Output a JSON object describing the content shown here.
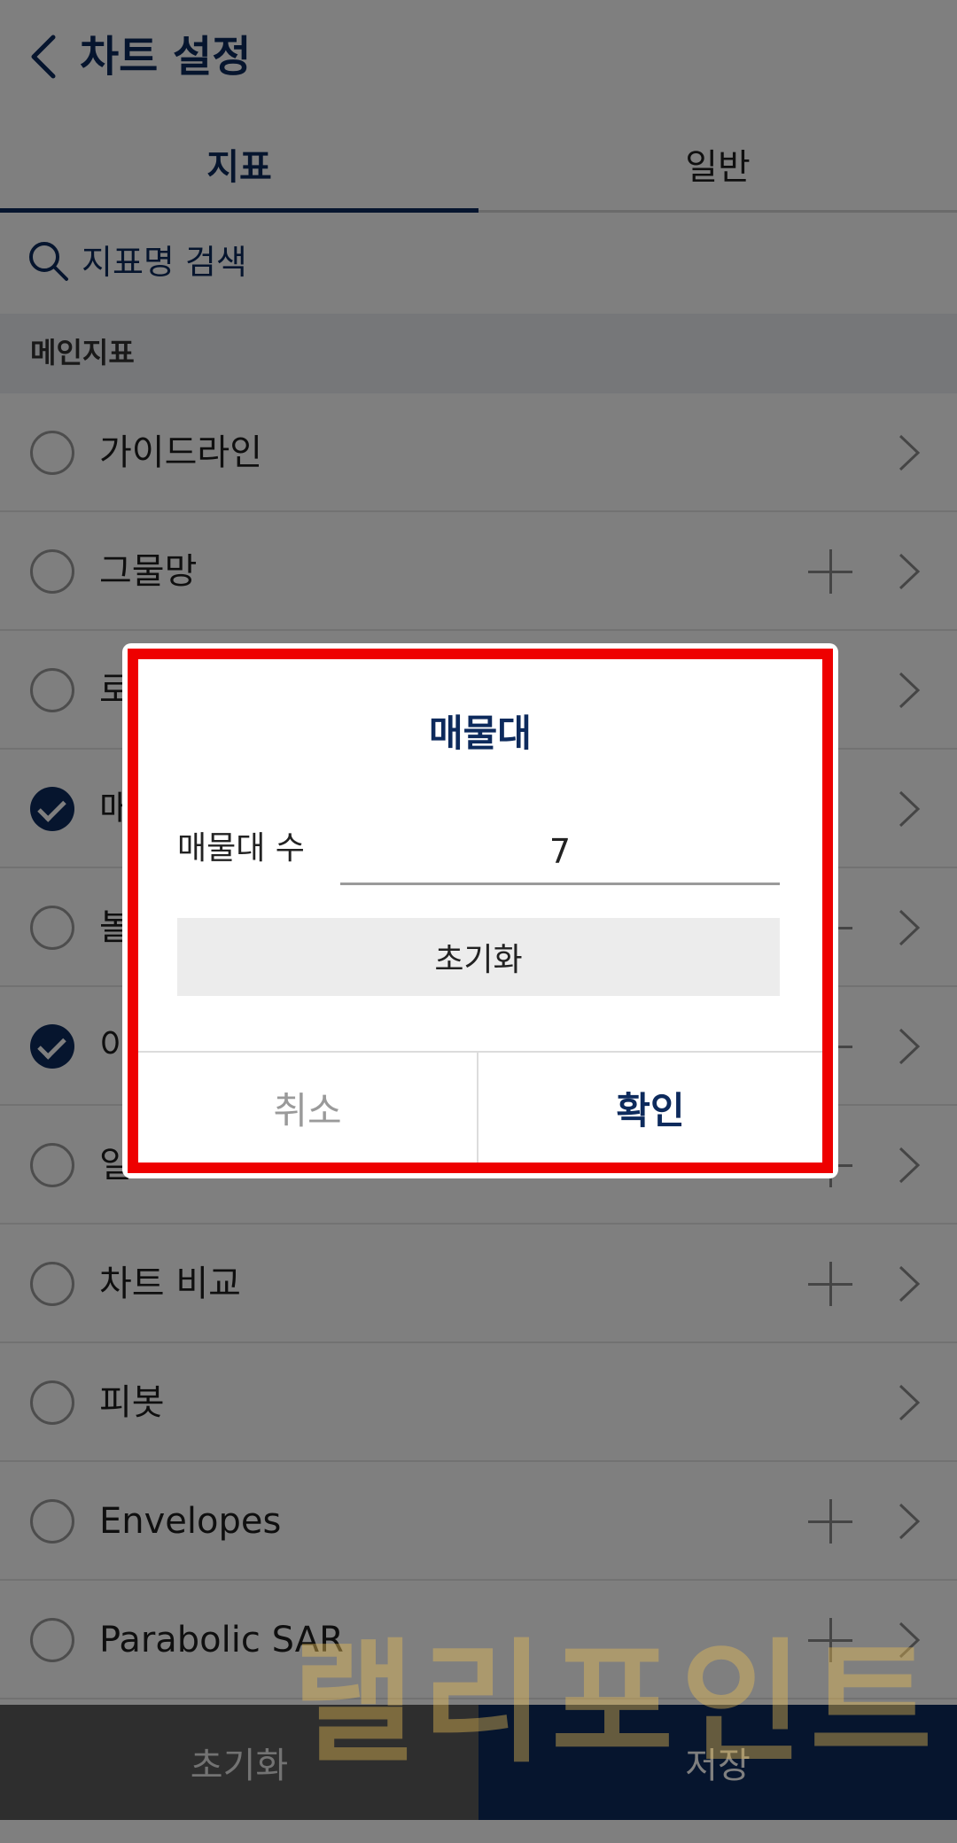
{
  "header": {
    "title": "차트 설정",
    "back_icon": "chevron-left-icon"
  },
  "tabs": [
    {
      "label": "지표",
      "active": true
    },
    {
      "label": "일반",
      "active": false
    }
  ],
  "search": {
    "placeholder": "지표명 검색",
    "icon": "search-icon"
  },
  "section": {
    "label": "메인지표"
  },
  "list": {
    "items": [
      {
        "label": "가이드라인",
        "checked": false,
        "has_plus": false
      },
      {
        "label": "그물망",
        "checked": false,
        "has_plus": true
      },
      {
        "label": "로",
        "checked": false,
        "has_plus": false
      },
      {
        "label": "매",
        "checked": true,
        "has_plus": false
      },
      {
        "label": "볼",
        "checked": false,
        "has_plus": true
      },
      {
        "label": "이",
        "checked": true,
        "has_plus": true
      },
      {
        "label": "일",
        "checked": false,
        "has_plus": true
      },
      {
        "label": "차트 비교",
        "checked": false,
        "has_plus": true
      },
      {
        "label": "피봇",
        "checked": false,
        "has_plus": false
      },
      {
        "label": "Envelopes",
        "checked": false,
        "has_plus": true
      },
      {
        "label": "Parabolic SAR",
        "checked": false,
        "has_plus": true
      }
    ]
  },
  "bottom_bar": {
    "reset_label": "초기화",
    "save_label": "저장"
  },
  "dialog": {
    "title": "매물대",
    "field_label": "매물대 수",
    "field_value": "7",
    "reset_label": "초기화",
    "cancel_label": "취소",
    "confirm_label": "확인"
  },
  "watermark": {
    "text": "랠리포인트"
  },
  "colors": {
    "brand_navy": "#0d2a5c",
    "highlight_red": "#ee0000",
    "watermark_gold": "#e9bd55"
  }
}
